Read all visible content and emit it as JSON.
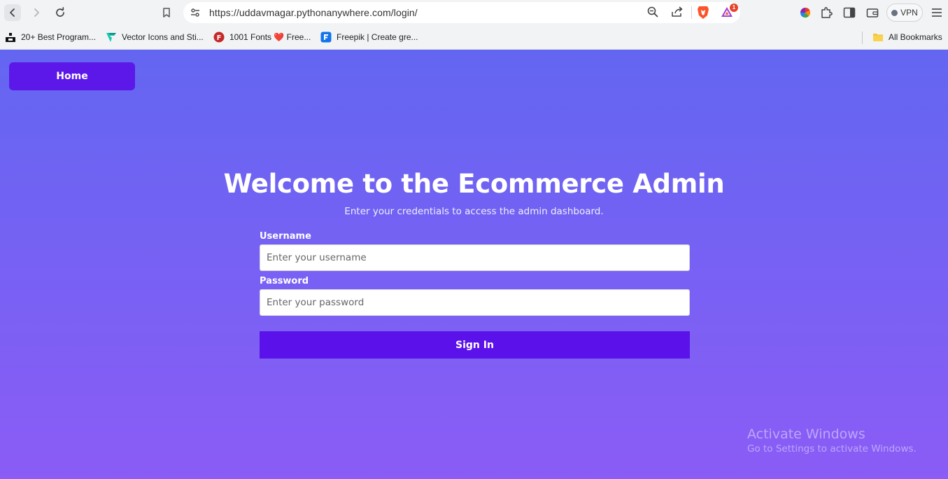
{
  "browser": {
    "url": "https://uddavmagar.pythonanywhere.com/login/",
    "rewards_badge": "1",
    "vpn_label": "VPN",
    "bookmarks": [
      {
        "label": "20+ Best Program...",
        "icon": "stack-icon"
      },
      {
        "label": "Vector Icons and Sti...",
        "icon": "flaticon-icon"
      },
      {
        "label": "1001 Fonts ❤️ Free...",
        "icon": "fonts-icon"
      },
      {
        "label": "Freepik | Create gre...",
        "icon": "freepik-icon"
      }
    ],
    "all_bookmarks_label": "All Bookmarks"
  },
  "page": {
    "home_button": "Home",
    "title": "Welcome to the Ecommerce Admin",
    "subtitle": "Enter your credentials to access the admin dashboard.",
    "form": {
      "username_label": "Username",
      "username_placeholder": "Enter your username",
      "password_label": "Password",
      "password_placeholder": "Enter your password",
      "submit_label": "Sign In"
    }
  },
  "os_overlay": {
    "line1": "Activate Windows",
    "line2": "Go to Settings to activate Windows."
  },
  "colors": {
    "gradient_top": "#6366f1",
    "gradient_bottom": "#8b5cf6",
    "button": "#5b18e8"
  }
}
